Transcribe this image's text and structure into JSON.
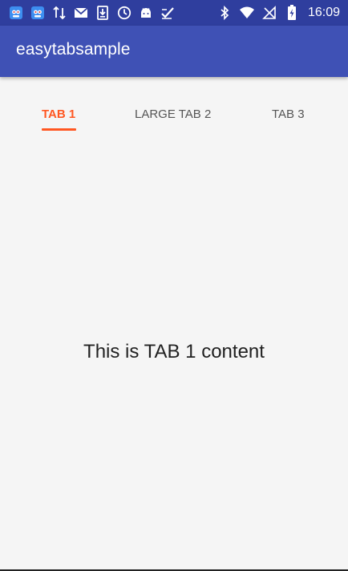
{
  "status_bar": {
    "time": "16:09",
    "left_icons": [
      "app-notification-icon",
      "app-notification-icon",
      "data-transfer-icon",
      "gmail-icon",
      "download-icon",
      "clock-icon",
      "android-icon",
      "check-app-icon"
    ],
    "right_icons": [
      "bluetooth-icon",
      "wifi-icon",
      "no-signal-icon",
      "battery-charging-icon"
    ],
    "background_color": "#2f3e9e"
  },
  "app_bar": {
    "title": "easytabsample",
    "background_color": "#3f51b5"
  },
  "tabs": [
    {
      "label": "TAB 1",
      "selected": true
    },
    {
      "label": "LARGE TAB 2",
      "selected": false
    },
    {
      "label": "TAB 3",
      "selected": false
    }
  ],
  "tab_colors": {
    "selected": "#ff5722",
    "unselected": "#555555"
  },
  "content": {
    "text": "This is TAB 1 content"
  }
}
